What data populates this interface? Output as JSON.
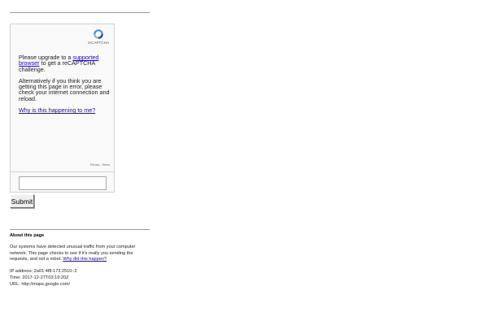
{
  "captcha": {
    "logo_text": "reCAPTCHA",
    "upgrade_prefix": "Please upgrade to a ",
    "upgrade_link": "supported browser",
    "upgrade_suffix": " to get a reCAPTCHA challenge.",
    "alternative_text": "Alternatively if you think you are getting this page in error, please check your internet connection and reload.",
    "why_link": "Why is this happening to me?",
    "privacy_link": "Privacy",
    "link_separator": " - ",
    "terms_link": "Terms",
    "response_value": ""
  },
  "submit_label": "Submit",
  "about": {
    "title": "About this page",
    "body": "Our systems have detected unusual traffic from your computer network. This page checks to see if it's really you sending the requests, and not a robot. ",
    "why_link": "Why did this happen?",
    "ip_label": "IP address: ",
    "ip_value": "2a01:4f8:173:2510::2",
    "time_label": "Time: ",
    "time_value": "2017-12-27T03:19:20Z",
    "url_label": "URL: ",
    "url_value": "http://maps.google.com/"
  }
}
